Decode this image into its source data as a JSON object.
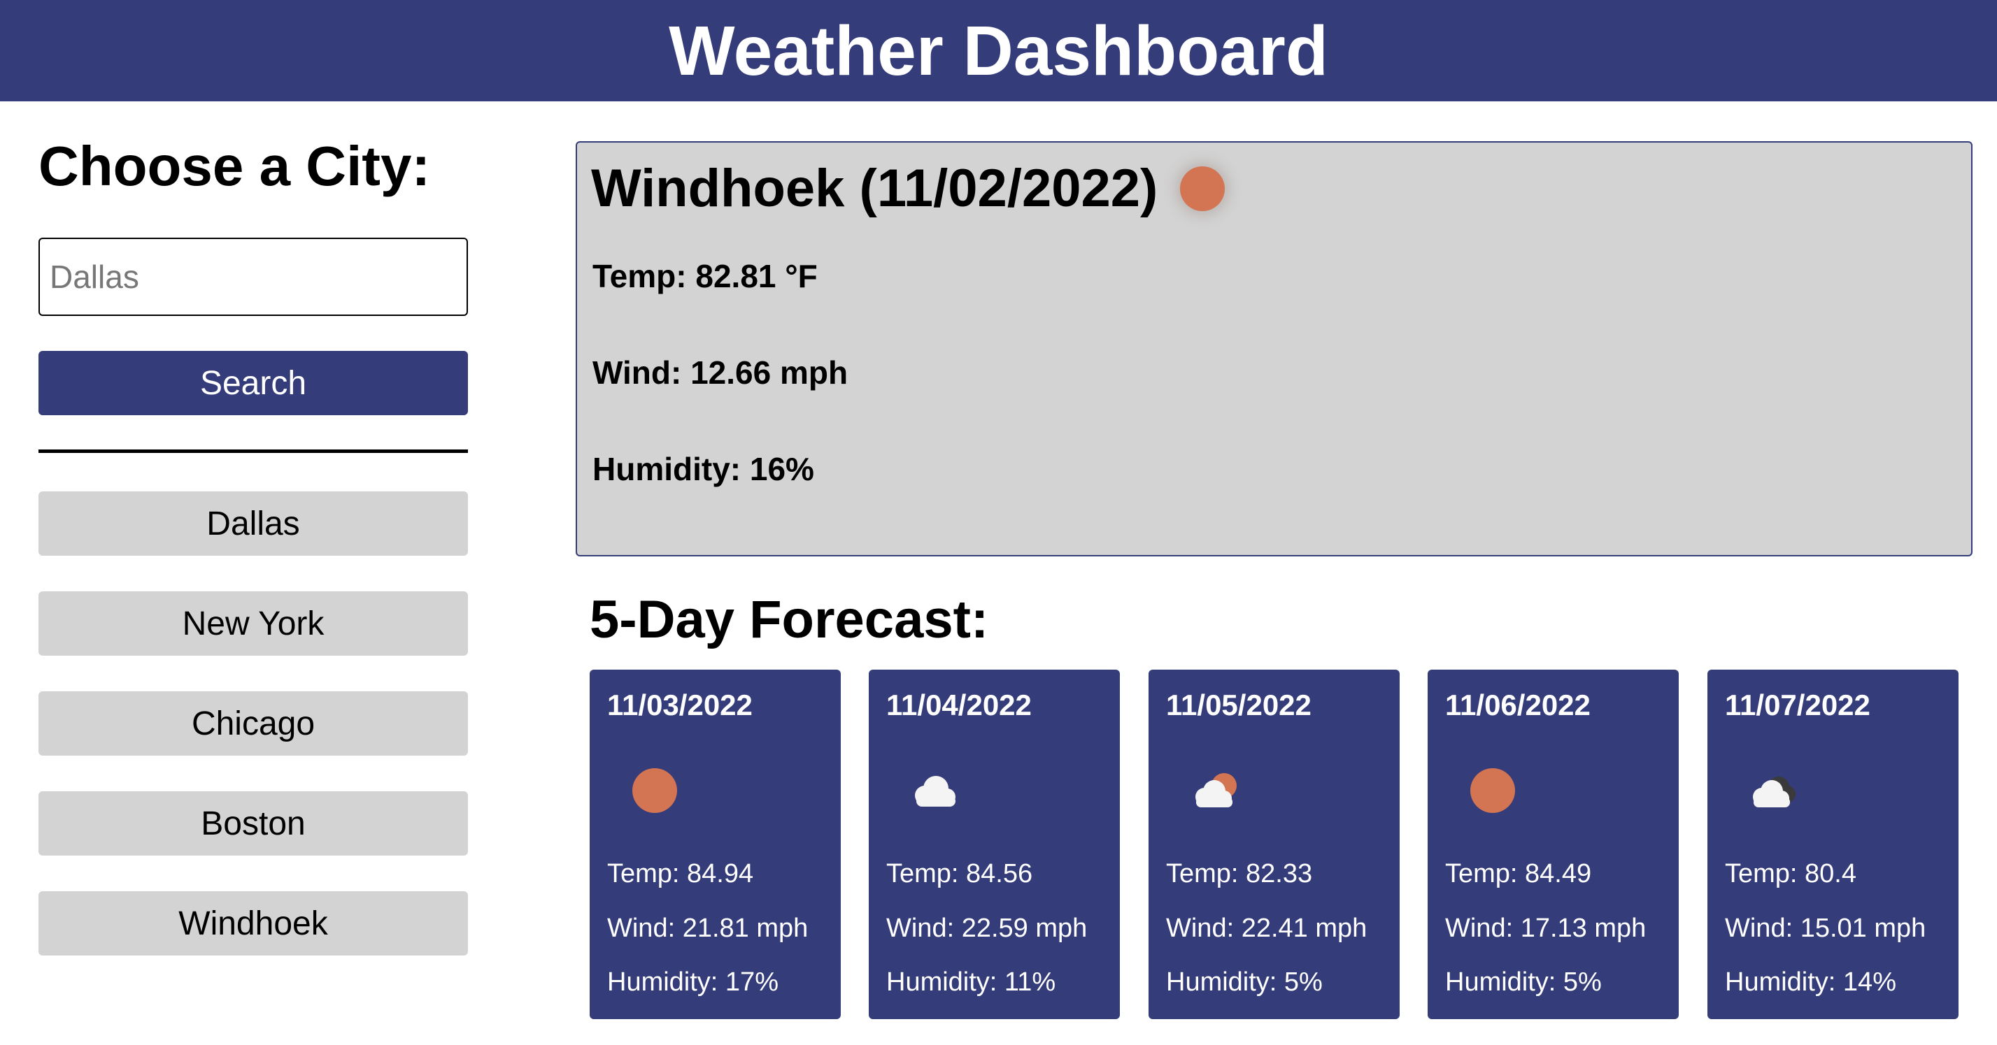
{
  "header": {
    "title": "Weather Dashboard"
  },
  "sidebar": {
    "heading": "Choose a City:",
    "search_placeholder": "Dallas",
    "search_label": "Search",
    "history": [
      "Dallas",
      "New York",
      "Chicago",
      "Boston",
      "Windhoek"
    ]
  },
  "current": {
    "title": "Windhoek (11/02/2022)",
    "icon": "sun-icon",
    "temp": "Temp: 82.81 °F",
    "wind": "Wind: 12.66 mph",
    "humidity": "Humidity: 16%"
  },
  "forecast": {
    "title": "5-Day Forecast:",
    "days": [
      {
        "date": "11/03/2022",
        "icon": "sun-icon",
        "temp": "Temp: 84.94",
        "wind": "Wind: 21.81 mph",
        "humidity": "Humidity: 17%"
      },
      {
        "date": "11/04/2022",
        "icon": "cloud-icon",
        "temp": "Temp: 84.56",
        "wind": "Wind: 22.59 mph",
        "humidity": "Humidity: 11%"
      },
      {
        "date": "11/05/2022",
        "icon": "partly-cloudy-icon",
        "temp": "Temp: 82.33",
        "wind": "Wind: 22.41 mph",
        "humidity": "Humidity: 5%"
      },
      {
        "date": "11/06/2022",
        "icon": "sun-icon",
        "temp": "Temp: 84.49",
        "wind": "Wind: 17.13 mph",
        "humidity": "Humidity: 5%"
      },
      {
        "date": "11/07/2022",
        "icon": "broken-clouds-icon",
        "temp": "Temp: 80.4",
        "wind": "Wind: 15.01 mph",
        "humidity": "Humidity: 14%"
      }
    ]
  },
  "colors": {
    "primary": "#353c7a",
    "panel": "#d3d3d3",
    "sun": "#d37452"
  }
}
